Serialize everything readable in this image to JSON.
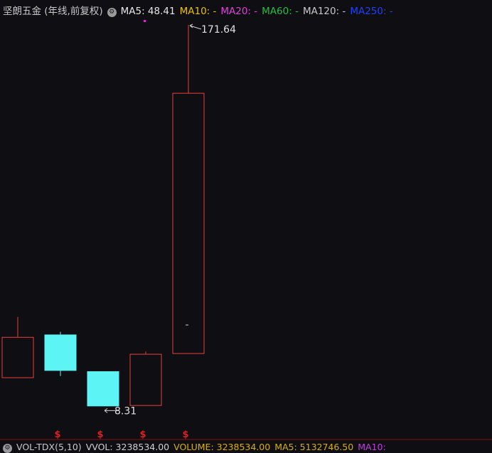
{
  "header": {
    "title": "坚朗五金 (年线,前复权)",
    "ma": [
      {
        "label": "MA5:",
        "value": "48.41",
        "color": "#e6e6e6"
      },
      {
        "label": "MA10:",
        "value": "-",
        "color": "#e8c000"
      },
      {
        "label": "MA20:",
        "value": "-",
        "color": "#e040e0"
      },
      {
        "label": "MA60:",
        "value": "-",
        "color": "#20c040"
      },
      {
        "label": "MA120:",
        "value": "-",
        "color": "#c8c8c8"
      },
      {
        "label": "MA250:",
        "value": "-",
        "color": "#2040ff"
      }
    ]
  },
  "chart_data": {
    "type": "candlestick",
    "ylim": [
      8.31,
      171.64
    ],
    "candles": [
      {
        "open": 42.5,
        "close": 25.5,
        "high": 50.8,
        "low": 25.5,
        "direction": "up"
      },
      {
        "open": 43.5,
        "close": 28.5,
        "high": 44.6,
        "low": 26.3,
        "direction": "down"
      },
      {
        "open": 28.3,
        "close": 13.8,
        "high": 28.3,
        "low": 13.8,
        "direction": "down"
      },
      {
        "open": 14.0,
        "close": 35.5,
        "high": 36.5,
        "low": 14.0,
        "direction": "up"
      },
      {
        "open": 35.5,
        "close": 143.5,
        "high": 171.64,
        "low": 35.5,
        "direction": "up"
      }
    ],
    "annotations": {
      "max_label": "171.64",
      "min_label": "8.31"
    },
    "markers": [
      "$",
      "$",
      "$",
      "$"
    ],
    "colors": {
      "up": "#e8403c",
      "down": "#5cf4f4",
      "background": "#0f0e12"
    }
  },
  "volume_bar": {
    "indicator": "VOL-TDX(5,10)",
    "items": [
      {
        "label": "VVOL:",
        "value": "3238534.00",
        "color": "#d0d0d0"
      },
      {
        "label": "VOLUME:",
        "value": "3238534.00",
        "color": "#d8b000"
      },
      {
        "label": "MA5:",
        "value": "5132746.50",
        "color": "#d8b000"
      },
      {
        "label": "MA10:",
        "value": "",
        "color": "#c040e0"
      }
    ]
  }
}
